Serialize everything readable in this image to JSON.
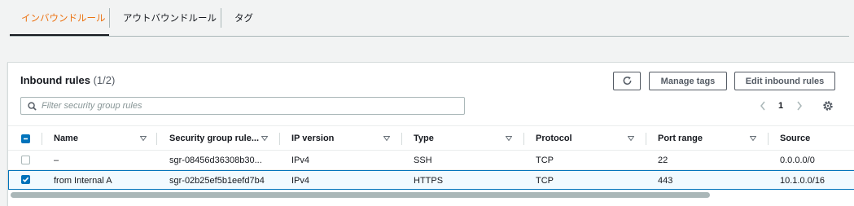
{
  "tabs": [
    {
      "label": "インバウンドルール",
      "active": true
    },
    {
      "label": "アウトバウンドルール",
      "active": false
    },
    {
      "label": "タグ",
      "active": false
    }
  ],
  "panel": {
    "title": "Inbound rules",
    "count": "(1/2)",
    "buttons": {
      "refresh_icon": "refresh-icon",
      "manage_tags": "Manage tags",
      "edit_inbound_rules": "Edit inbound rules"
    },
    "search": {
      "placeholder": "Filter security group rules",
      "value": ""
    },
    "pagination": {
      "current_page": "1"
    }
  },
  "table": {
    "columns": [
      "Name",
      "Security group rule...",
      "IP version",
      "Type",
      "Protocol",
      "Port range",
      "Source"
    ],
    "rows": [
      {
        "selected": false,
        "name": "–",
        "rule_id": "sgr-08456d36308b30...",
        "ip_version": "IPv4",
        "type": "SSH",
        "protocol": "TCP",
        "port_range": "22",
        "source": "0.0.0.0/0"
      },
      {
        "selected": true,
        "name": "from Internal A",
        "rule_id": "sgr-02b25ef5b1eefd7b4",
        "ip_version": "IPv4",
        "type": "HTTPS",
        "protocol": "TCP",
        "port_range": "443",
        "source": "10.1.0.0/16"
      }
    ]
  },
  "colors": {
    "active_tab": "#ec7211",
    "checkbox": "#0073bb",
    "selected_row_bg": "#f1faff",
    "border": "#eaeded"
  }
}
